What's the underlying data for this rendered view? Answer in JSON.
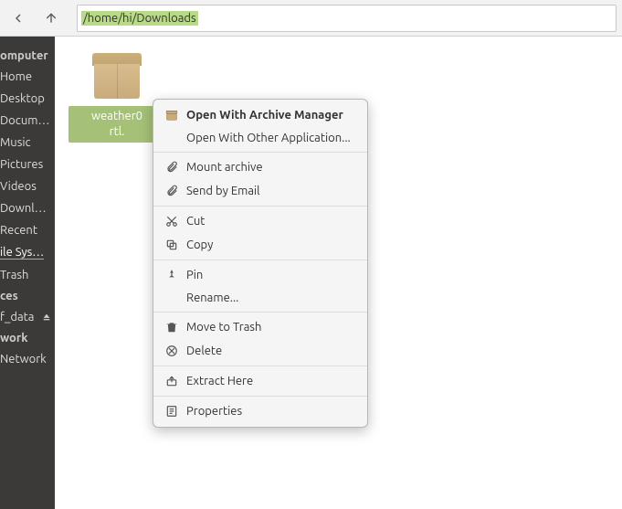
{
  "toolbar": {
    "path": "/home/hi/Downloads"
  },
  "sidebar": {
    "sections": [
      {
        "title": "omputer",
        "items": [
          {
            "label": "Home"
          },
          {
            "label": "Desktop"
          },
          {
            "label": "Docum…"
          },
          {
            "label": "Music"
          },
          {
            "label": "Pictures"
          },
          {
            "label": "Videos"
          },
          {
            "label": "Downl…"
          },
          {
            "label": "Recent"
          },
          {
            "label": "ile Sys…",
            "active": true
          },
          {
            "label": "Trash"
          }
        ]
      },
      {
        "title": "ces",
        "items": [
          {
            "label": "f_data",
            "eject": true
          }
        ]
      },
      {
        "title": "work",
        "items": [
          {
            "label": "Network"
          }
        ]
      }
    ]
  },
  "file": {
    "line1": "weather0",
    "line2": "rtl."
  },
  "menu": {
    "open_archive": "Open With Archive Manager",
    "open_other": "Open With Other Application...",
    "mount": "Mount archive",
    "email": "Send by Email",
    "cut": "Cut",
    "copy": "Copy",
    "pin": "Pin",
    "rename": "Rename...",
    "trash": "Move to Trash",
    "delete": "Delete",
    "extract": "Extract Here",
    "properties": "Properties"
  }
}
